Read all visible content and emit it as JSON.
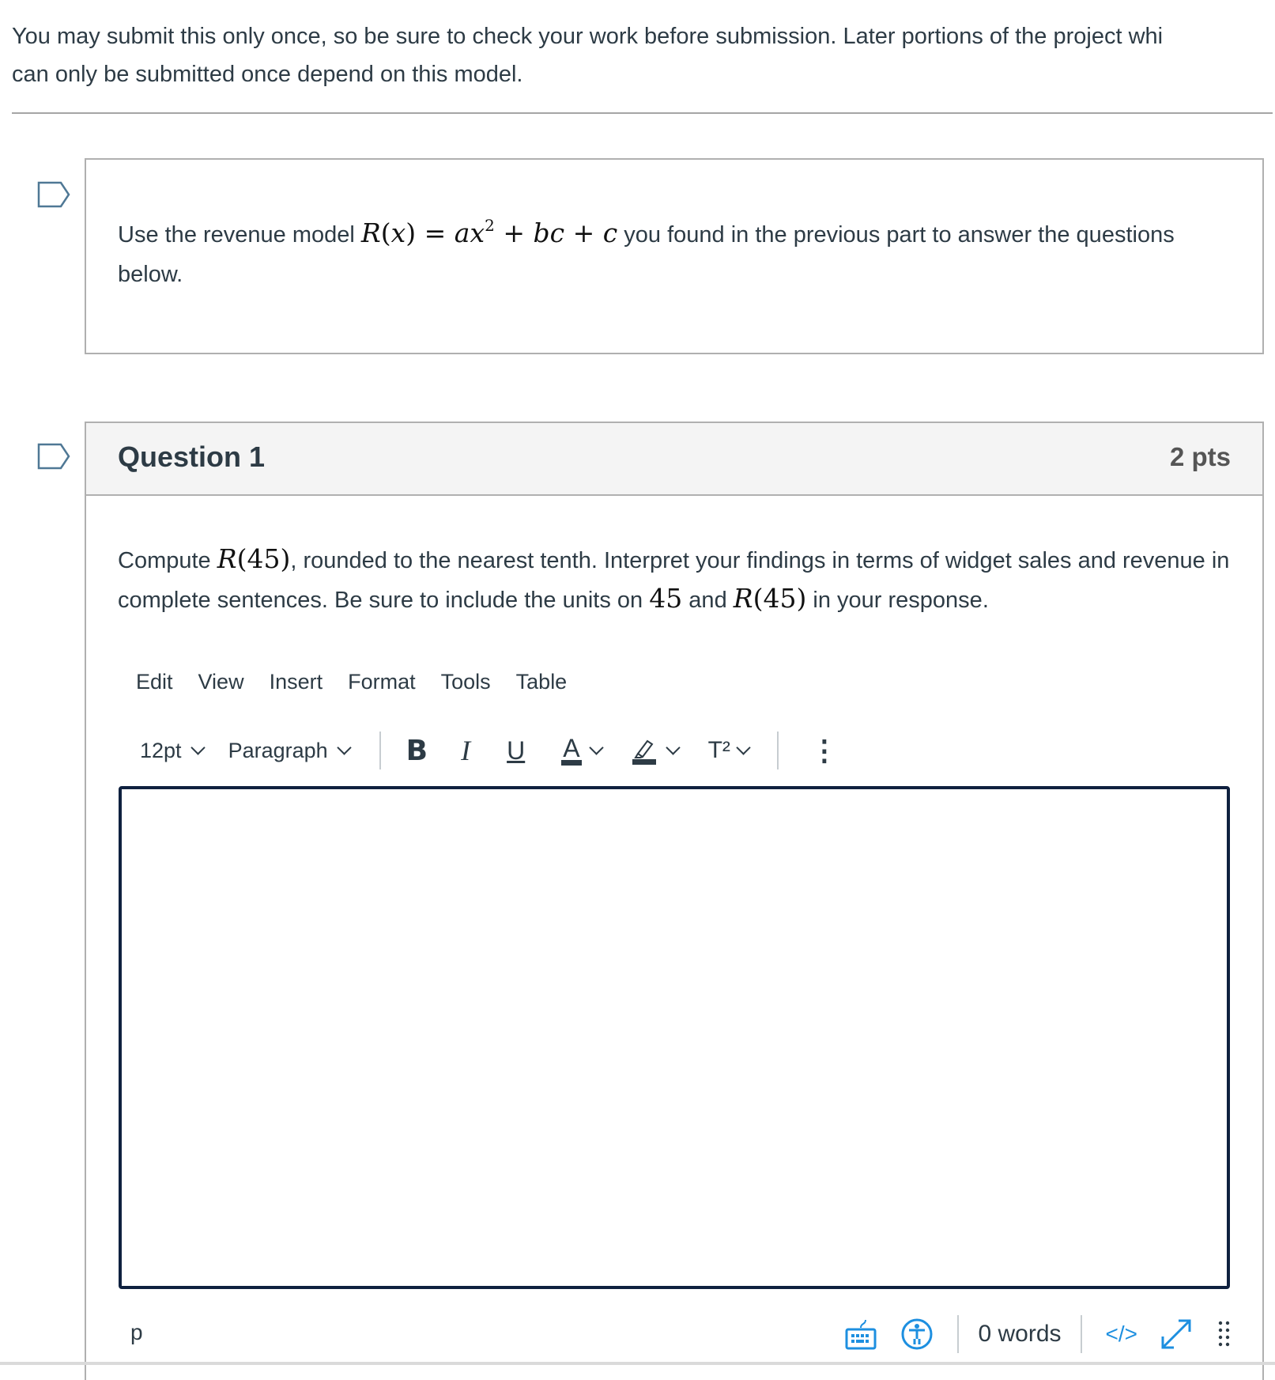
{
  "intro": {
    "line1": "You may submit this only once, so be sure to check your work before submission.  Later portions of the project whi",
    "line2": "can only be submitted once depend on this model."
  },
  "stimulus": {
    "text_before": "Use the revenue model ",
    "formula": "R(x) = ax² + bc + c",
    "text_after": " you found in the previous part to answer the questions below."
  },
  "question": {
    "title": "Question 1",
    "points": "2 pts",
    "text_1": "Compute ",
    "math_1": "R(45)",
    "text_2": ", rounded to the nearest tenth. Interpret your findings in terms of widget sales and revenue in complete sentences.  Be sure to include the units on ",
    "math_2": "45",
    "text_3": " and ",
    "math_3": "R(45)",
    "text_4": " in your response."
  },
  "editor": {
    "menu": [
      "Edit",
      "View",
      "Insert",
      "Format",
      "Tools",
      "Table"
    ],
    "font_size": "12pt",
    "block_format": "Paragraph",
    "bold_label": "B",
    "italic_label": "I",
    "underline_label": "U",
    "text_color_label": "A",
    "superscript_label": "T²",
    "more_label": "⋮",
    "content": "",
    "status_path": "p",
    "word_count": "0 words",
    "html_toggle_label": "</>"
  },
  "colors": {
    "text": "#2d3b45",
    "accent_blue": "#1d8fe0",
    "editor_border": "#0f213f",
    "bookmark": "#4f7895"
  }
}
